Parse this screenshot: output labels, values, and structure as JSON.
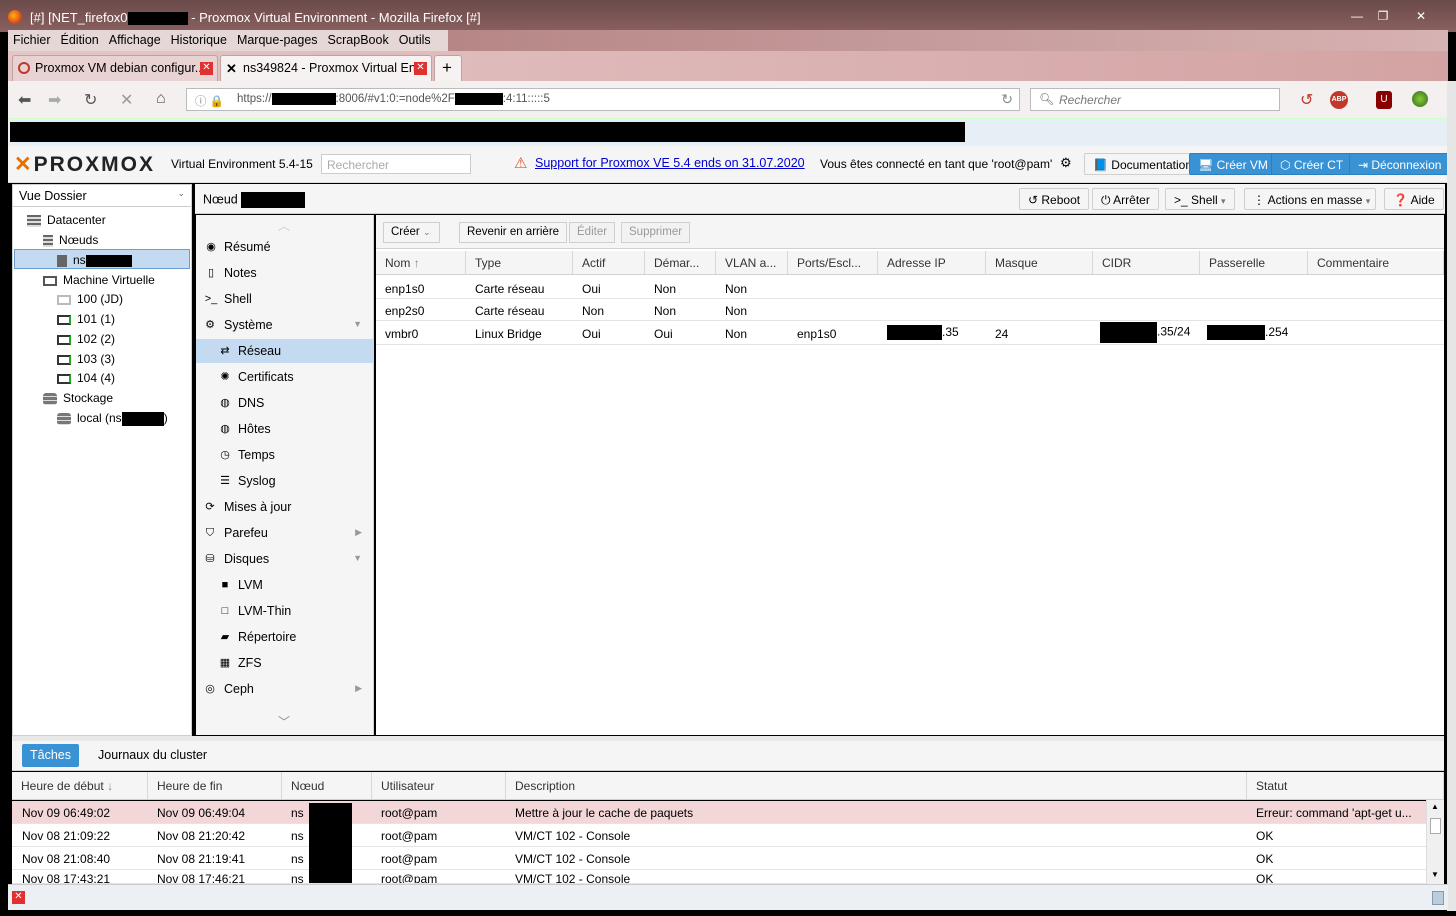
{
  "window": {
    "title": "[#] [NET_firefox0",
    "title_suffix": "- Proxmox Virtual Environment - Mozilla Firefox [#]"
  },
  "menu": [
    "Fichier",
    "Édition",
    "Affichage",
    "Historique",
    "Marque-pages",
    "ScrapBook",
    "Outils",
    "?"
  ],
  "tabs": [
    {
      "label": "Proxmox VM debian configur..."
    },
    {
      "label": "ns349824 - Proxmox Virtual En..."
    }
  ],
  "nav": {
    "url_prefix": "https://",
    "url_mid": ":8006/#v1:0:=node%2F",
    "url_suffix": ":4:11:::::5",
    "search_placeholder": "Rechercher"
  },
  "pve": {
    "brand": "PROXMOX",
    "version": "Virtual Environment 5.4-15",
    "search_placeholder": "Rechercher",
    "support_link": "Support for Proxmox VE 5.4 ends on 31.07.2020",
    "logged_in": "Vous êtes connecté en tant que 'root@pam'",
    "buttons": {
      "doc": "Documentation",
      "create_vm": "Créer VM",
      "create_ct": "Créer CT",
      "logout": "Déconnexion"
    }
  },
  "tree": {
    "view": "Vue Dossier",
    "items": [
      "Datacenter",
      "Nœuds",
      "ns",
      "Machine Virtuelle",
      "100 (JD)",
      "101 (1)",
      "102 (2)",
      "103 (3)",
      "104 (4)",
      "Stockage",
      "local (ns",
      ")"
    ]
  },
  "node": {
    "title": "Nœud",
    "buttons": {
      "reboot": "Reboot",
      "stop": "Arrêter",
      "shell": "Shell",
      "bulk": "Actions en masse",
      "help": "Aide"
    }
  },
  "nav_menu": [
    "Résumé",
    "Notes",
    "Shell",
    "Système",
    "Réseau",
    "Certificats",
    "DNS",
    "Hôtes",
    "Temps",
    "Syslog",
    "Mises à jour",
    "Parefeu",
    "Disques",
    "LVM",
    "LVM-Thin",
    "Répertoire",
    "ZFS",
    "Ceph"
  ],
  "network": {
    "toolbar": {
      "create": "Créer",
      "revert": "Revenir en arrière",
      "edit": "Éditer",
      "delete": "Supprimer"
    },
    "columns": [
      "Nom",
      "Type",
      "Actif",
      "Démar...",
      "VLAN a...",
      "Ports/Escl...",
      "Adresse IP",
      "Masque",
      "CIDR",
      "Passerelle",
      "Commentaire"
    ],
    "rows": [
      {
        "name": "enp1s0",
        "type": "Carte réseau",
        "active": "Oui",
        "autostart": "Non",
        "vlan": "Non",
        "ports": "",
        "ip": "",
        "mask": "",
        "cidr": "",
        "gateway": "",
        "comment": ""
      },
      {
        "name": "enp2s0",
        "type": "Carte réseau",
        "active": "Non",
        "autostart": "Non",
        "vlan": "Non",
        "ports": "",
        "ip": "",
        "mask": "",
        "cidr": "",
        "gateway": "",
        "comment": ""
      },
      {
        "name": "vmbr0",
        "type": "Linux Bridge",
        "active": "Oui",
        "autostart": "Oui",
        "vlan": "Non",
        "ports": "enp1s0",
        "ip": ".35",
        "mask": "24",
        "cidr": ".35/24",
        "gateway": ".254",
        "comment": ""
      }
    ]
  },
  "log": {
    "tabs": [
      "Tâches",
      "Journaux du cluster"
    ],
    "columns": [
      "Heure de début",
      "Heure de fin",
      "Nœud",
      "Utilisateur",
      "Description",
      "Statut"
    ],
    "rows": [
      {
        "start": "Nov 09 06:49:02",
        "end": "Nov 09 06:49:04",
        "node": "ns",
        "user": "root@pam",
        "desc": "Mettre à jour le cache de paquets",
        "status": "Erreur: command 'apt-get u..."
      },
      {
        "start": "Nov 08 21:09:22",
        "end": "Nov 08 21:20:42",
        "node": "ns",
        "user": "root@pam",
        "desc": "VM/CT 102 - Console",
        "status": "OK"
      },
      {
        "start": "Nov 08 21:08:40",
        "end": "Nov 08 21:19:41",
        "node": "ns",
        "user": "root@pam",
        "desc": "VM/CT 102 - Console",
        "status": "OK"
      },
      {
        "start": "Nov 08 17:43:21",
        "end": "Nov 08 17:46:21",
        "node": "ns",
        "user": "root@pam",
        "desc": "VM/CT 102 - Console",
        "status": "OK"
      }
    ]
  },
  "colors": {
    "accent": "#3892d4",
    "error_row": "#f3d6d7",
    "active_nav": "#c3daf0",
    "brand_x": "#e57000"
  }
}
